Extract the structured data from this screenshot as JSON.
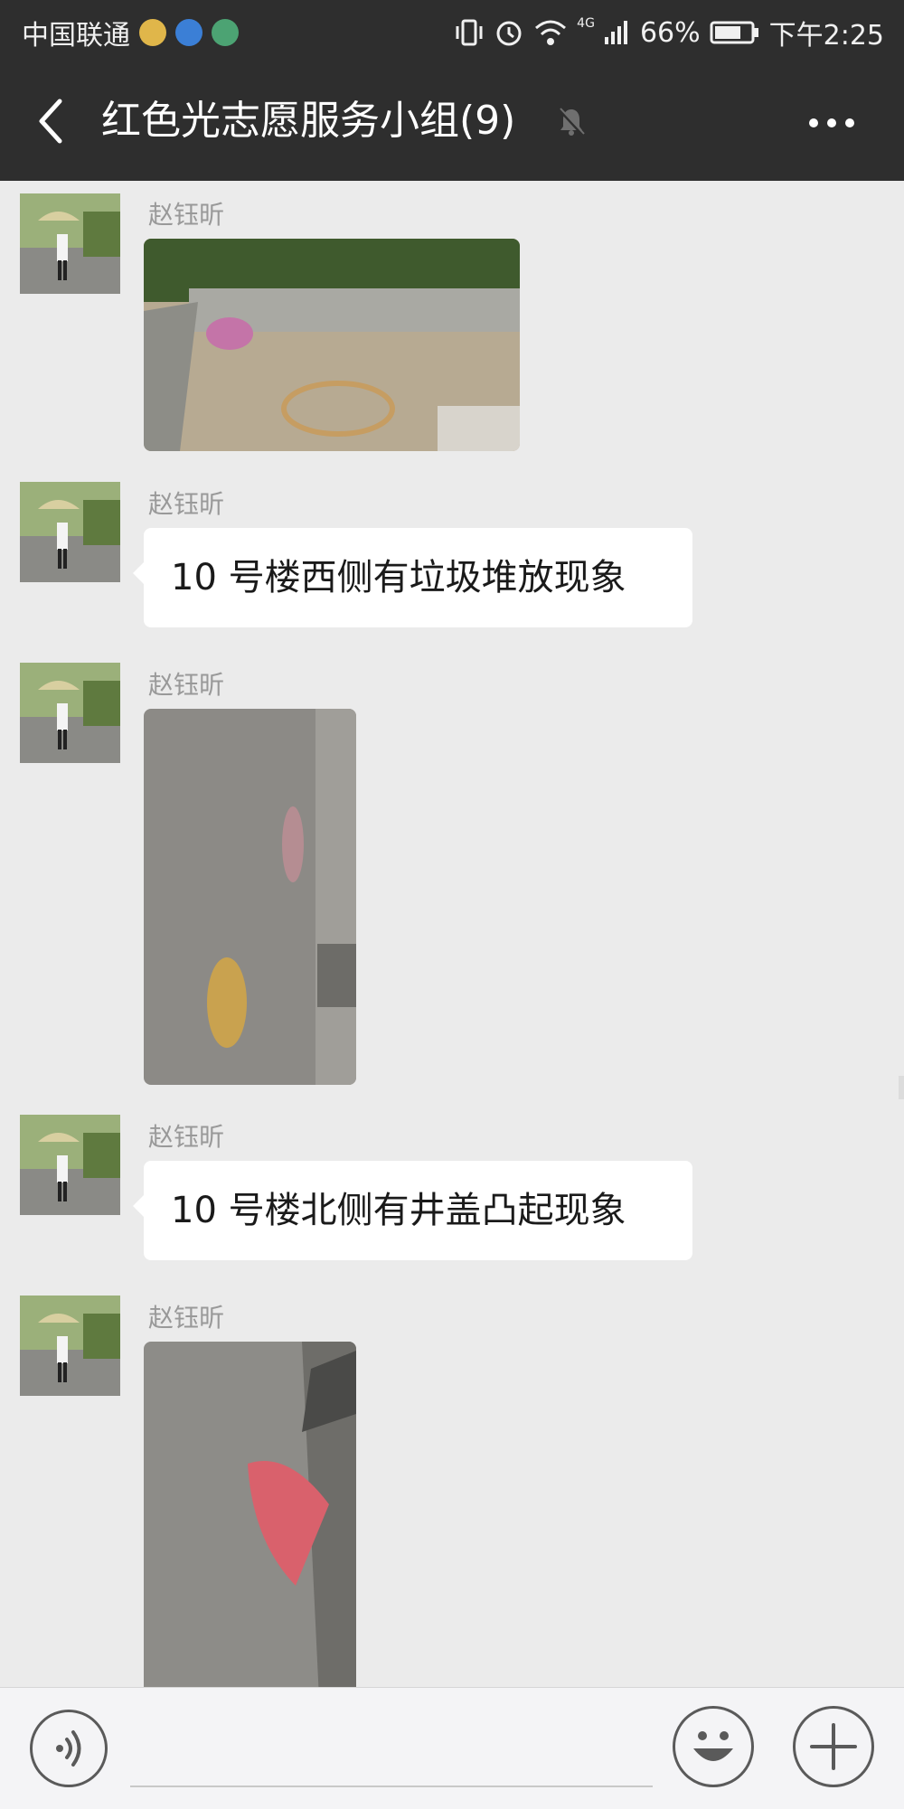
{
  "status_bar": {
    "carrier": "中国联通",
    "battery": "66%",
    "network": "4G",
    "time": "下午2:25",
    "app_icons": [
      "message-notification-icon",
      "chat-notification-icon",
      "app-notification-icon"
    ]
  },
  "header": {
    "title": "红色光志愿服务小组(9)",
    "back_icon": "back-arrow-icon",
    "mute_icon": "mute-bell-icon",
    "more_icon": "more-dots-icon"
  },
  "messages": [
    {
      "type": "image",
      "sender": "赵钰昕",
      "image": "photo-trash-near-curb"
    },
    {
      "type": "text",
      "sender": "赵钰昕",
      "text": "10 号楼西侧有垃圾堆放现象"
    },
    {
      "type": "image",
      "sender": "赵钰昕",
      "image": "photo-manhole-covers"
    },
    {
      "type": "text",
      "sender": "赵钰昕",
      "text": "10 号楼北侧有井盖凸起现象"
    },
    {
      "type": "image",
      "sender": "赵钰昕",
      "image": "photo-red-umbrella-on-sidewalk"
    }
  ],
  "bottom_bar": {
    "voice_icon": "voice-input-icon",
    "emoji_icon": "emoji-icon",
    "plus_icon": "plus-icon"
  },
  "colors": {
    "top_bar": "#2e2e2e",
    "chat_background": "#ebebeb",
    "bubble": "#ffffff",
    "sender_name": "#999999"
  }
}
